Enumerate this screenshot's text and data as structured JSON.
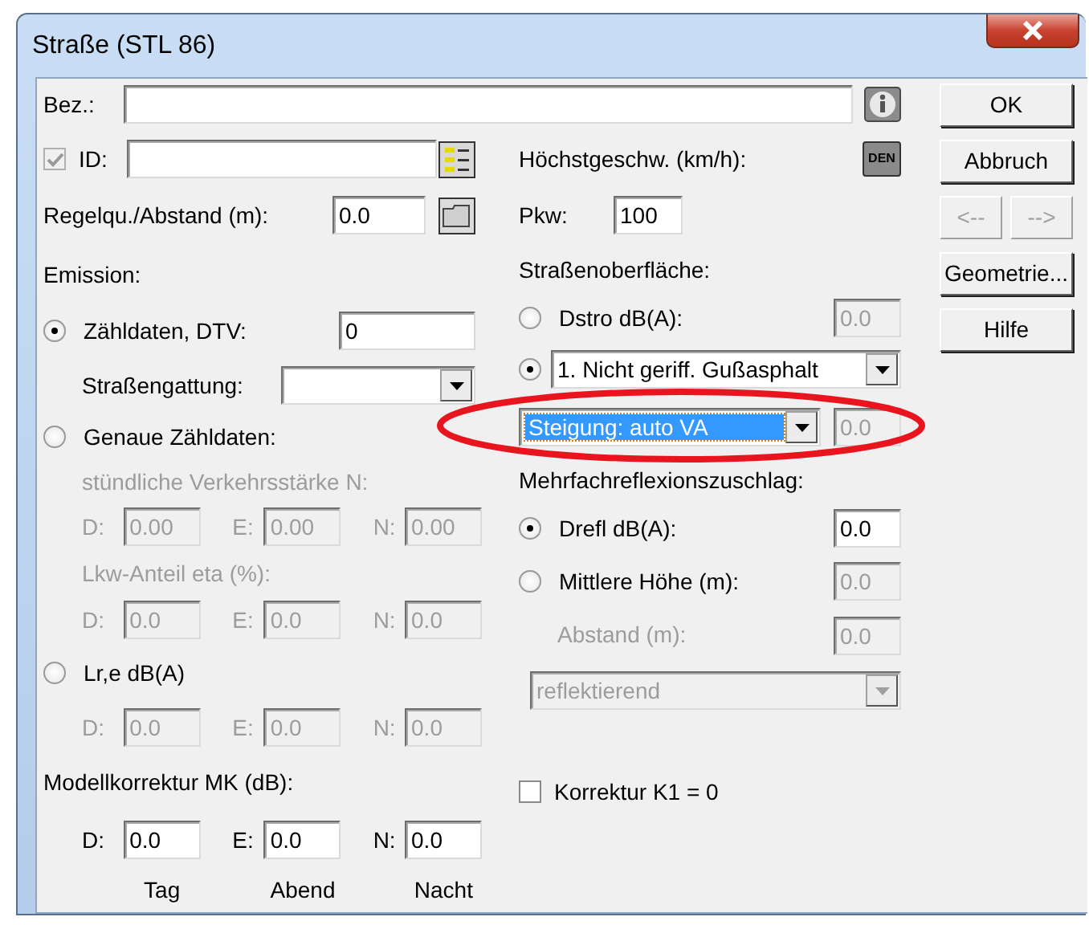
{
  "window": {
    "title": "Straße (STL 86)"
  },
  "name": {
    "label": "Bez.:"
  },
  "id": {
    "label": "ID:",
    "checked": true,
    "disabled": true
  },
  "spacing": {
    "label": "Regelqu./Abstand (m):",
    "value": "0.0"
  },
  "speed": {
    "label": "Höchstgeschw. (km/h):",
    "badge": "DEN"
  },
  "car_speed": {
    "label": "Pkw:",
    "value": "100"
  },
  "emission": {
    "heading": "Emission:",
    "options": [
      {
        "kind": "count",
        "label": "Zähldaten, DTV:",
        "selected": true,
        "value": "0",
        "road_class": {
          "label": "Straßengattung:"
        }
      },
      {
        "kind": "hourly",
        "label": "Genaue Zähldaten:",
        "selected": false,
        "groups": [
          {
            "label": "stündliche Verkehrsstärke N:",
            "disabled": true,
            "fields": [
              {
                "label": "D:",
                "value": "0.00"
              },
              {
                "label": "E:",
                "value": "0.00"
              },
              {
                "label": "N:",
                "value": "0.00"
              }
            ]
          },
          {
            "label": "Lkw-Anteil eta (%):",
            "disabled": true,
            "fields": [
              {
                "label": "D:",
                "value": "0.0"
              },
              {
                "label": "E:",
                "value": "0.0"
              },
              {
                "label": "N:",
                "value": "0.0"
              }
            ]
          }
        ]
      },
      {
        "kind": "level",
        "label": "Lr,e dB(A)",
        "selected": false,
        "groups": [
          {
            "disabled": true,
            "fields": [
              {
                "label": "D:",
                "value": "0.0"
              },
              {
                "label": "E:",
                "value": "0.0"
              },
              {
                "label": "N:",
                "value": "0.0"
              }
            ]
          }
        ]
      }
    ]
  },
  "model_correction": {
    "label": "Modellkorrektur MK (dB):",
    "fields": [
      {
        "label": "D:",
        "value": "0.0",
        "caption": "Tag"
      },
      {
        "label": "E:",
        "value": "0.0",
        "caption": "Abend"
      },
      {
        "label": "N:",
        "value": "0.0",
        "caption": "Nacht"
      }
    ]
  },
  "surface": {
    "heading": "Straßenoberfläche:",
    "options": [
      {
        "kind": "value",
        "label": "Dstro dB(A):",
        "selected": false,
        "value": "0.0",
        "disabled": true
      },
      {
        "kind": "list",
        "selected": true,
        "value": "1. Nicht geriff. Gußasphalt"
      }
    ],
    "gradient": {
      "value": "Steigung: auto VA",
      "focused": true,
      "reading": "0.0",
      "reading_disabled": true
    }
  },
  "reflection": {
    "heading": "Mehrfachreflexionszuschlag:",
    "options": [
      {
        "label": "Drefl dB(A):",
        "selected": true,
        "value": "0.0",
        "disabled": false
      },
      {
        "label": "Mittlere Höhe (m):",
        "selected": false,
        "value": "0.0",
        "disabled": true
      }
    ],
    "distance": {
      "label": "Abstand (m):",
      "value": "0.0",
      "disabled": true
    },
    "mode": {
      "value": "reflektierend",
      "disabled": true
    }
  },
  "k1": {
    "label": "Korrektur K1 = 0",
    "checked": false
  },
  "buttons": [
    {
      "label": "OK",
      "disabled": false
    },
    {
      "label": "Abbruch",
      "disabled": false
    },
    {
      "label": "<--",
      "disabled": true
    },
    {
      "label": "-->",
      "disabled": true
    },
    {
      "label": "Geometrie...",
      "disabled": false
    },
    {
      "label": "Hilfe",
      "disabled": false
    }
  ],
  "annotation": {
    "kind": "ellipse"
  }
}
